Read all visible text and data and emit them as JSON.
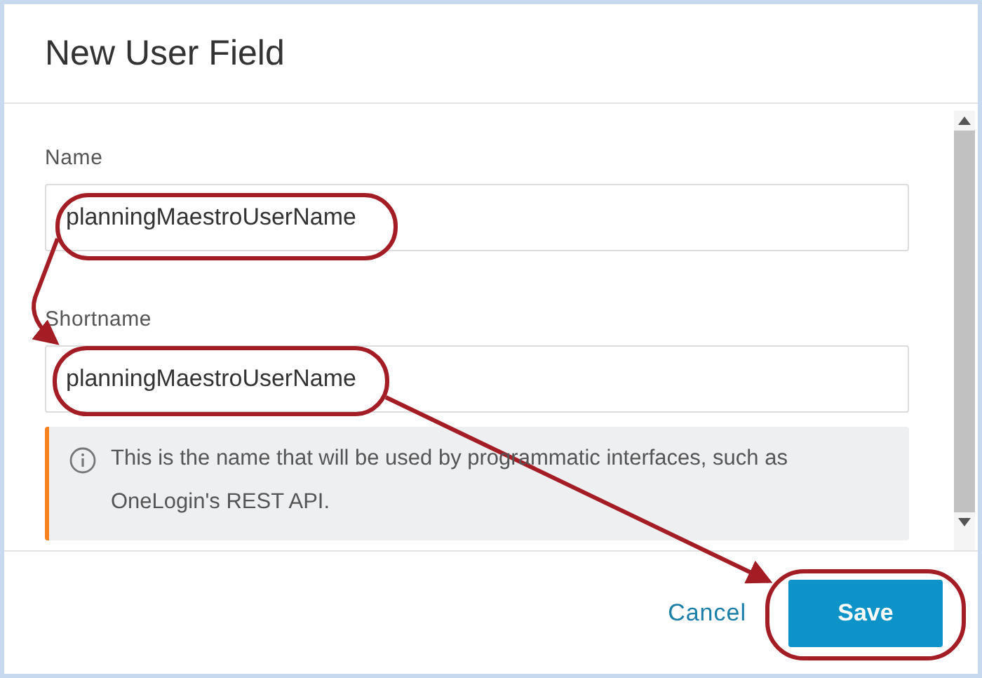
{
  "dialog": {
    "title": "New User Field"
  },
  "fields": [
    {
      "label": "Name",
      "value": "planningMaestroUserName"
    },
    {
      "label": "Shortname",
      "value": "planningMaestroUserName"
    }
  ],
  "info": {
    "text": "This is the name that will be used by programmatic interfaces, such as OneLogin's REST API."
  },
  "buttons": [
    {
      "label": "Cancel",
      "kind": "link"
    },
    {
      "label": "Save",
      "kind": "primary"
    }
  ]
}
